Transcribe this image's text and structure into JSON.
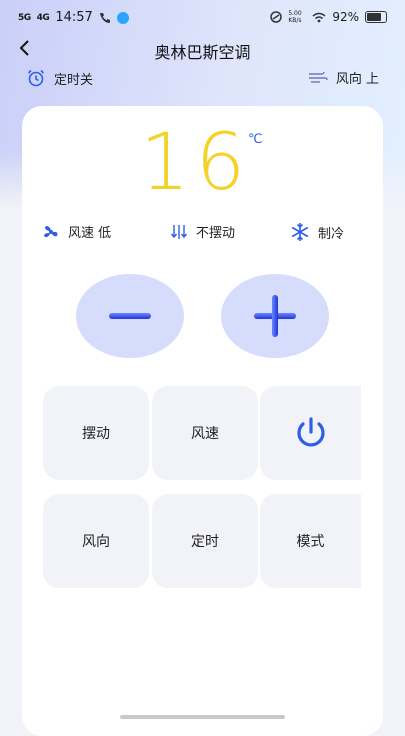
{
  "status_bar": {
    "signal1": "5G",
    "signal2": "4G",
    "time": "14:57",
    "net_speed": "5.00 KB/s",
    "battery": "92%"
  },
  "header": {
    "title": "奥林巴斯空调"
  },
  "top_row": {
    "timer_label": "定时关",
    "wind_direction_label": "风向 上"
  },
  "display": {
    "temperature": "16",
    "unit": "℃"
  },
  "status_items": {
    "fan_speed": "风速  低",
    "swing": "不摆动",
    "mode": "制冷"
  },
  "buttons": {
    "swing": "摆动",
    "fan_speed": "风速",
    "wind_direction": "风向",
    "timer": "定时",
    "mode": "模式"
  },
  "colors": {
    "accent_blue": "#2d5ee8",
    "temp_yellow": "#f3d22a",
    "button_bg": "#d6dcfb"
  }
}
